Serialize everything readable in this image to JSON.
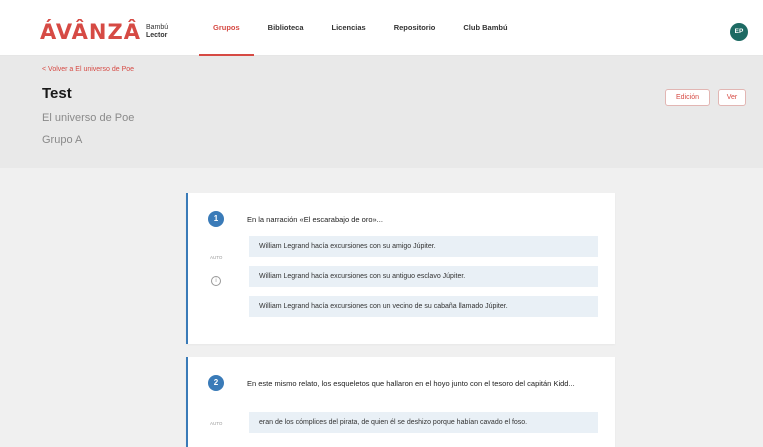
{
  "brand": {
    "name": "ÁVÂNZÂ",
    "sub1": "Bambú",
    "sub2": "Lector"
  },
  "nav": {
    "items": [
      "Grupos",
      "Biblioteca",
      "Licencias",
      "Repositorio",
      "Club Bambú"
    ],
    "active": "Grupos"
  },
  "user": {
    "initials": "EP"
  },
  "header": {
    "back": "< Volver a El universo de Poe",
    "title": "Test",
    "subtitle": "El universo de Poe",
    "group": "Grupo A",
    "edit": "Edición",
    "view": "Ver"
  },
  "questions": [
    {
      "number": "1",
      "auto": "AUTO",
      "text": "En la narración «El escarabajo de oro»...",
      "options": [
        "William Legrand hacía excursiones con su amigo Júpiter.",
        "William Legrand hacía excursiones con su antiguo esclavo Júpiter.",
        "William Legrand hacía excursiones con un vecino de su cabaña llamado Júpiter."
      ]
    },
    {
      "number": "2",
      "auto": "AUTO",
      "text": "En este mismo relato, los esqueletos que hallaron en el hoyo junto con el tesoro del capitán Kidd...",
      "options": [
        "eran de los cómplices del pirata, de quien él se deshizo porque habían cavado el foso."
      ]
    }
  ],
  "colors": {
    "accent": "#d64a44",
    "primary": "#3a7bb8",
    "avatar": "#1d6a63"
  }
}
